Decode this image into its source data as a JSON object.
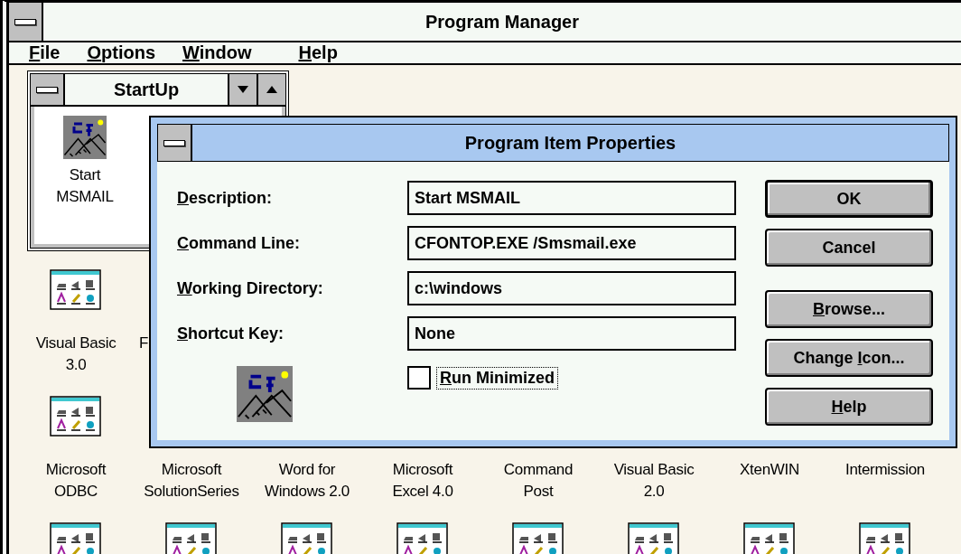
{
  "window": {
    "title": "Program Manager"
  },
  "menu": [
    {
      "underlined": "F",
      "text_after": "ile"
    },
    {
      "underlined": "O",
      "text_after": "ptions"
    },
    {
      "underlined": "W",
      "text_after": "indow"
    },
    {
      "underlined": "H",
      "text_after": "elp"
    }
  ],
  "group_window": {
    "title": "StartUp",
    "items": [
      {
        "lines": [
          "Start",
          "MSMAIL"
        ]
      }
    ]
  },
  "program_rows": [
    [
      {
        "kind": "full",
        "lines": [
          "Visual Basic",
          "3.0"
        ]
      },
      {
        "kind": "label",
        "lines": [
          "F"
        ]
      }
    ],
    [
      {
        "kind": "full",
        "lines": [
          "Microsoft",
          "ODBC"
        ]
      },
      {
        "kind": "label",
        "lines": [
          "Microsoft",
          "SolutionSeries"
        ]
      },
      {
        "kind": "label",
        "lines": [
          "Word for",
          "Windows 2.0"
        ]
      },
      {
        "kind": "label",
        "lines": [
          "Microsoft",
          "Excel 4.0"
        ]
      },
      {
        "kind": "label",
        "lines": [
          "Command",
          "Post"
        ]
      },
      {
        "kind": "label",
        "lines": [
          "Visual Basic",
          "2.0"
        ]
      },
      {
        "kind": "label",
        "lines": [
          "XtenWIN"
        ]
      },
      {
        "kind": "label",
        "lines": [
          "Intermission"
        ]
      }
    ],
    [
      {
        "kind": "icon"
      },
      {
        "kind": "icon"
      },
      {
        "kind": "icon"
      },
      {
        "kind": "icon"
      },
      {
        "kind": "icon"
      },
      {
        "kind": "icon"
      },
      {
        "kind": "icon"
      },
      {
        "kind": "icon"
      }
    ]
  ],
  "dialog": {
    "title": "Program Item Properties",
    "fields": [
      {
        "underlined": "D",
        "text_after": "escription:",
        "value": "Start MSMAIL"
      },
      {
        "underlined": "C",
        "text_after": "ommand Line:",
        "value": "CFONTOP.EXE /Smsmail.exe"
      },
      {
        "underlined": "W",
        "text_after": "orking Directory:",
        "value": "c:\\windows"
      },
      {
        "underlined": "S",
        "text_after": "hortcut Key:",
        "value": "None"
      }
    ],
    "checkbox": {
      "underlined": "R",
      "text_after": "un Minimized",
      "checked": false,
      "focused": true
    },
    "buttons": [
      {
        "text_before": "OK",
        "default": true
      },
      {
        "text_before": "Cancel",
        "default": false
      },
      {
        "underlined": "B",
        "text_after": "rowse...",
        "default": false
      },
      {
        "text_before": "Change ",
        "underlined": "I",
        "text_after": "con...",
        "default": false
      },
      {
        "underlined": "H",
        "text_after": "elp",
        "default": false
      }
    ]
  }
}
